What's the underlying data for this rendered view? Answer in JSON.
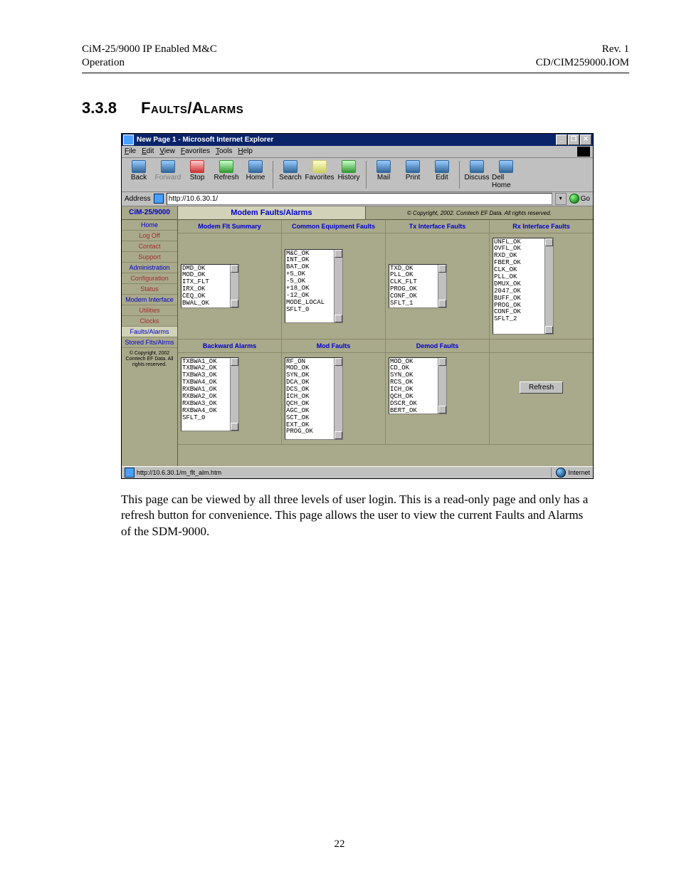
{
  "header": {
    "left_line1": "CiM-25/9000 IP Enabled M&C",
    "left_line2": "Operation",
    "right_line1": "Rev. 1",
    "right_line2": "CD/CIM259000.IOM"
  },
  "section": {
    "number": "3.3.8",
    "title": "Faults/Alarms"
  },
  "window": {
    "title": "New Page 1 - Microsoft Internet Explorer",
    "menus": [
      "File",
      "Edit",
      "View",
      "Favorites",
      "Tools",
      "Help"
    ],
    "toolbar": [
      {
        "label": "Back",
        "kind": "blue"
      },
      {
        "label": "Forward",
        "kind": "blue",
        "disabled": true
      },
      {
        "label": "Stop",
        "kind": "red"
      },
      {
        "label": "Refresh",
        "kind": "green"
      },
      {
        "label": "Home",
        "kind": "blue"
      },
      {
        "sep": true
      },
      {
        "label": "Search",
        "kind": "blue"
      },
      {
        "label": "Favorites",
        "kind": "yel"
      },
      {
        "label": "History",
        "kind": "green"
      },
      {
        "sep": true
      },
      {
        "label": "Mail",
        "kind": "blue"
      },
      {
        "label": "Print",
        "kind": "blue"
      },
      {
        "label": "Edit",
        "kind": "blue"
      },
      {
        "sep": true
      },
      {
        "label": "Discuss",
        "kind": "blue"
      },
      {
        "label": "Dell Home",
        "kind": "blue"
      }
    ],
    "address_label": "Address",
    "address_value": "http://10.6.30.1/",
    "go_label": "Go",
    "status_left": "http://10.6.30.1/m_flt_alm.htm",
    "status_right": "Internet"
  },
  "frame": {
    "product": "CiM-25/9000",
    "page_title": "Modem Faults/Alarms",
    "copyright": "© Copyright, 2002. Comtech EF Data. All rights reserved.",
    "sidebar": [
      {
        "label": "Home",
        "cls": "blue"
      },
      {
        "label": "Log Off",
        "cls": ""
      },
      {
        "label": "Contact",
        "cls": ""
      },
      {
        "label": "Support",
        "cls": ""
      },
      {
        "label": "Administration",
        "cls": "blue"
      },
      {
        "label": "Configuration",
        "cls": ""
      },
      {
        "label": "Status",
        "cls": ""
      },
      {
        "label": "Modem Interface",
        "cls": "blue"
      },
      {
        "label": "Utilities",
        "cls": ""
      },
      {
        "label": "Clocks",
        "cls": ""
      },
      {
        "label": "Faults/Alarms",
        "cls": "active"
      },
      {
        "label": "Stored Flts/Alrms",
        "cls": "blue"
      }
    ],
    "side_copy": "© Copyright, 2002\nComtech EF Data.\nAll rights reserved.",
    "row1_headers": [
      "Modem Flt Summary",
      "Common Equipment Faults",
      "Tx Interface Faults",
      "Rx Interface Faults"
    ],
    "row2_headers": [
      "Backward Alarms",
      "Mod Faults",
      "Demod Faults",
      ""
    ],
    "modem_flt_summary": [
      "DMD_OK",
      "MOD_OK",
      "ITX_FLT",
      "IRX_OK",
      "CEQ_OK",
      "BWAL_OK"
    ],
    "common_eq_faults": [
      "M&C_OK",
      "INT_OK",
      "BAT_OK",
      "+5_OK",
      "-5_OK",
      "+18_OK",
      "-12_OK",
      "MODE_LOCAL",
      "SFLT_0"
    ],
    "tx_interface_faults": [
      "TXD_OK",
      "PLL_OK",
      "CLK_FLT",
      "PROG_OK",
      "CONF_OK",
      "SFLT_1"
    ],
    "rx_interface_faults": [
      "UNFL_OK",
      "OVFL_OK",
      "RXD_OK",
      "FBER_OK",
      "CLK_OK",
      "PLL_OK",
      "DMUX_OK",
      "2047_OK",
      "BUFF_OK",
      "PROG_OK",
      "CONF_OK",
      "SFLT_2"
    ],
    "backward_alarms": [
      "TXBWA1_OK",
      "TXBWA2_OK",
      "TXBWA3_OK",
      "TXBWA4_OK",
      "RXBWA1_OK",
      "RXBWA2_OK",
      "RXBWA3_OK",
      "RXBWA4_OK",
      "SFLT_0"
    ],
    "mod_faults": [
      "RF_ON",
      "MOD_OK",
      "SYN_OK",
      "DCA_OK",
      "DCS_OK",
      "ICH_OK",
      "QCH_OK",
      "AGC_OK",
      "SCT_OK",
      "EXT_OK",
      "PROG_OK"
    ],
    "demod_faults": [
      "MOD_OK",
      "CD_OK",
      "SYN_OK",
      "RCS_OK",
      "ICH_OK",
      "QCH_OK",
      "DSCR_OK",
      "BERT_OK"
    ],
    "refresh_label": "Refresh"
  },
  "body_text": "This page can be viewed by all three levels of user login. This is a read-only page and only has a refresh button for convenience. This page allows the user to view the current Faults and Alarms of the SDM-9000.",
  "page_number": "22"
}
